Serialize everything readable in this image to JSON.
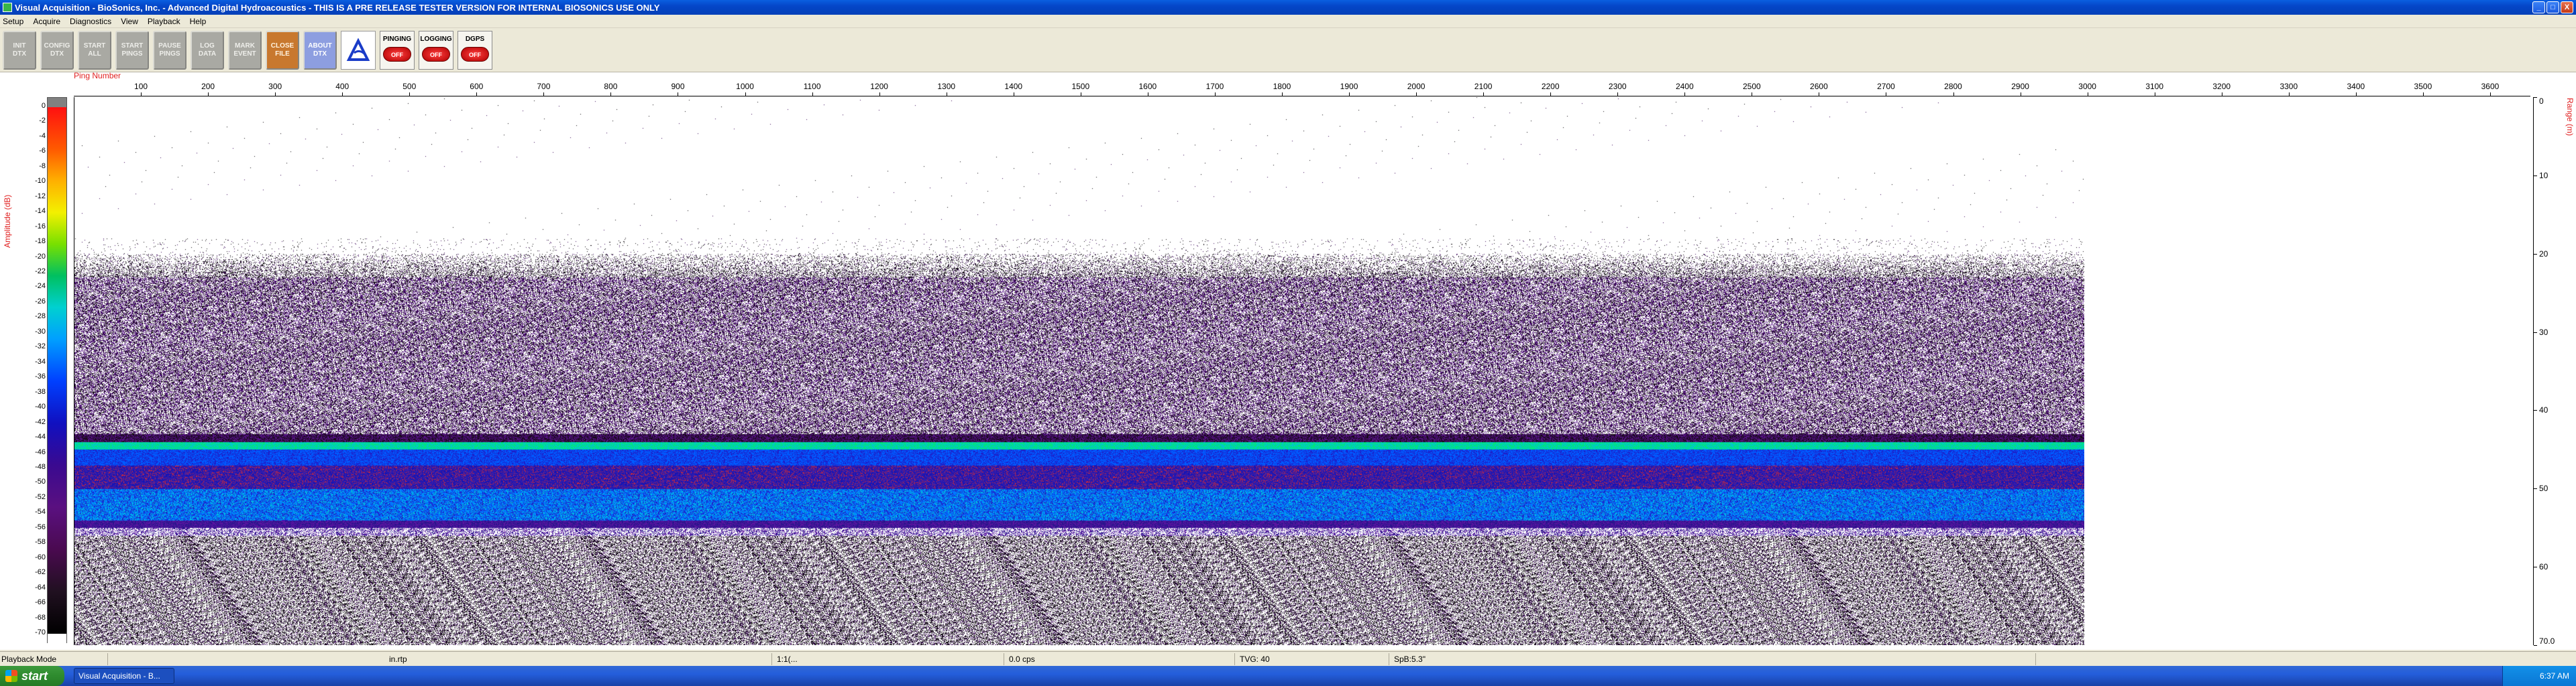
{
  "window": {
    "title": "Visual Acquisition  -  BioSonics, Inc.  -  Advanced Digital Hydroacoustics  -  THIS IS A PRE RELEASE TESTER VERSION FOR INTERNAL BIOSONICS USE ONLY",
    "minimize": "_",
    "maximize": "□",
    "close": "X"
  },
  "menu": [
    "Setup",
    "Acquire",
    "Diagnostics",
    "View",
    "Playback",
    "Help"
  ],
  "toolbar": {
    "buttons": [
      {
        "line1": "INIT",
        "line2": "DTX"
      },
      {
        "line1": "CONFIG",
        "line2": "DTX"
      },
      {
        "line1": "START",
        "line2": "ALL"
      },
      {
        "line1": "START",
        "line2": "PINGS"
      },
      {
        "line1": "PAUSE",
        "line2": "PINGS"
      },
      {
        "line1": "LOG",
        "line2": "DATA"
      },
      {
        "line1": "MARK",
        "line2": "EVENT"
      },
      {
        "line1": "CLOSE",
        "line2": "FILE"
      },
      {
        "line1": "ABOUT",
        "line2": "DTX"
      }
    ],
    "indicators": [
      {
        "label": "PINGING",
        "state": "OFF"
      },
      {
        "label": "LOGGING",
        "state": "OFF"
      },
      {
        "label": "DGPS",
        "state": "OFF"
      }
    ]
  },
  "echogram": {
    "amplitude_label": "Amplitude (dB)",
    "ping_label": "Ping Number",
    "range_label": "Range (m)",
    "amplitude_ticks": [
      "0",
      "-2",
      "-4",
      "-6",
      "-8",
      "-10",
      "-12",
      "-14",
      "-16",
      "-18",
      "-20",
      "-22",
      "-24",
      "-26",
      "-28",
      "-30",
      "-32",
      "-34",
      "-36",
      "-38",
      "-40",
      "-42",
      "-44",
      "-46",
      "-48",
      "-50",
      "-52",
      "-54",
      "-56",
      "-58",
      "-60",
      "-62",
      "-64",
      "-66",
      "-68",
      "-70"
    ],
    "ping_ticks": [
      "100",
      "200",
      "300",
      "400",
      "500",
      "600",
      "700",
      "800",
      "900",
      "1000",
      "1100",
      "1200",
      "1300",
      "1400",
      "1500",
      "1600",
      "1700",
      "1800",
      "1900",
      "2000",
      "2100",
      "2200",
      "2300",
      "2400",
      "2500",
      "2600",
      "2700",
      "2800",
      "2900",
      "3000",
      "3100",
      "3200",
      "3300",
      "3400",
      "3500",
      "3600"
    ],
    "range_ticks": [
      "0",
      "10",
      "20",
      "30",
      "40",
      "50",
      "60",
      "70.0"
    ],
    "ping_max": 3660,
    "data_last_ping": 3000,
    "range_max": 70
  },
  "status": {
    "mode": "Playback Mode",
    "file": "in.rtp",
    "field3": "1:1(...",
    "rate": "0.0 cps",
    "tvg": "TVG: 40",
    "spb": "SpB:5.3\""
  },
  "taskbar": {
    "start": "start",
    "task": "Visual Acquisition - B...",
    "clock": "6:37 AM"
  },
  "colors": {
    "accent_red": "#e02020",
    "taskbar_blue": "#245edb"
  }
}
